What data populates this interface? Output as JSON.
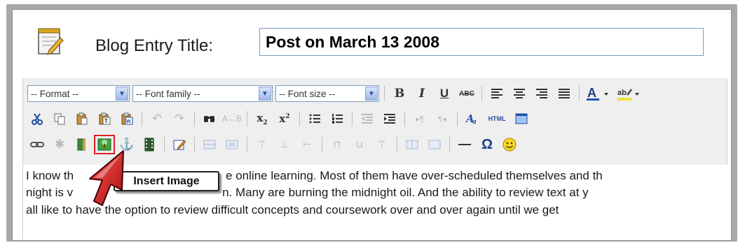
{
  "title_label": "Blog Entry Title:",
  "title_value": "Post on March 13 2008",
  "toolbar": {
    "format_select": "-- Format --",
    "font_family_select": "-- Font family --",
    "font_size_select": "-- Font size --",
    "bold": "B",
    "italic": "I",
    "underline": "U",
    "strikethrough": "ABC",
    "html_label": "HTML",
    "special_char": "Ω"
  },
  "tooltip": "Insert Image",
  "content_lines": [
    "I know th",
    "night is v",
    "all like to have the option to review difficult concepts and coursework over and over again until we get"
  ],
  "content_fragments": {
    "line1_right": "e online learning.  Most of them have over-scheduled themselves and th",
    "line2_right": "n.  Many are burning the midnight oil.  And the ability to review text at y"
  },
  "icons": [
    "notepad-icon",
    "cut-icon",
    "copy-icon",
    "paste-icon",
    "paste-text-icon",
    "paste-word-icon",
    "undo-icon",
    "redo-icon",
    "find-icon",
    "replace-icon",
    "subscript-icon",
    "superscript-icon",
    "bullet-list-icon",
    "numbered-list-icon",
    "outdent-icon",
    "indent-icon",
    "ltr-icon",
    "rtl-icon",
    "styles-icon",
    "html-icon",
    "fullscreen-icon",
    "link-icon",
    "unlink-icon",
    "anchor-icon",
    "insert-image-icon",
    "media-icon",
    "film-icon",
    "edit-icon",
    "table-icon",
    "smiley-icon",
    "cursor-icon"
  ],
  "colors": {
    "highlight": "#e02020",
    "toolbar_bg": "#efefef",
    "frame": "#a9a9a9"
  }
}
